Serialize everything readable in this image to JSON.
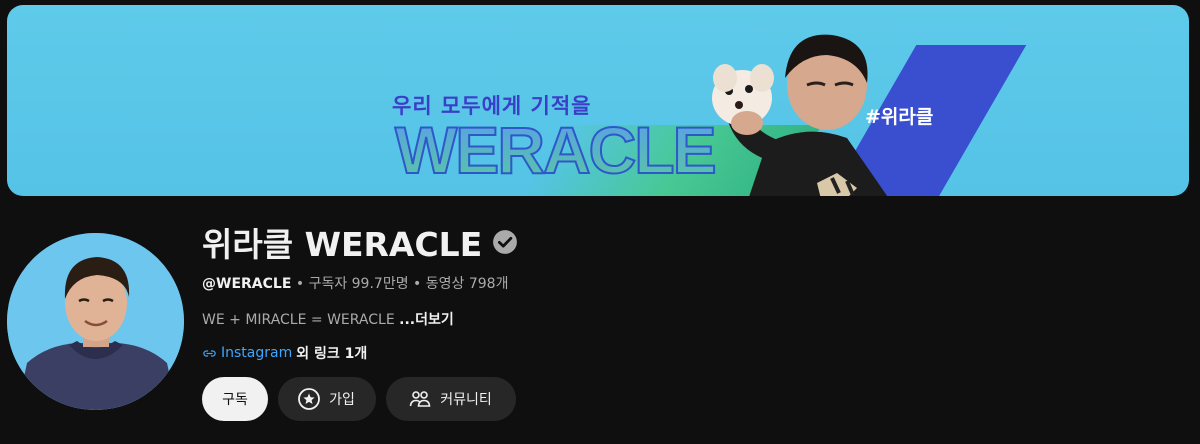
{
  "banner": {
    "tagline": "우리 모두에게 기적을",
    "wordmark": "WERACLE",
    "hashtag": "#위라클"
  },
  "channel": {
    "name": "위라클 WERACLE",
    "handle": "@WERACLE",
    "subscribers": "구독자 99.7만명",
    "videos": "동영상 798개",
    "separator": "•",
    "description": "WE + MIRACLE = WERACLE",
    "more_label": "...더보기",
    "link_label": "Instagram",
    "other_links": "외 링크 1개"
  },
  "buttons": {
    "subscribe": "구독",
    "join": "가입",
    "community": "커뮤니티"
  },
  "icons": {
    "verified": "verified-check-icon",
    "link": "link-icon",
    "join": "star-badge-icon",
    "community": "people-icon"
  },
  "colors": {
    "background": "#0f0f0f",
    "link": "#3ea6ff",
    "banner": "#5fcaea"
  }
}
